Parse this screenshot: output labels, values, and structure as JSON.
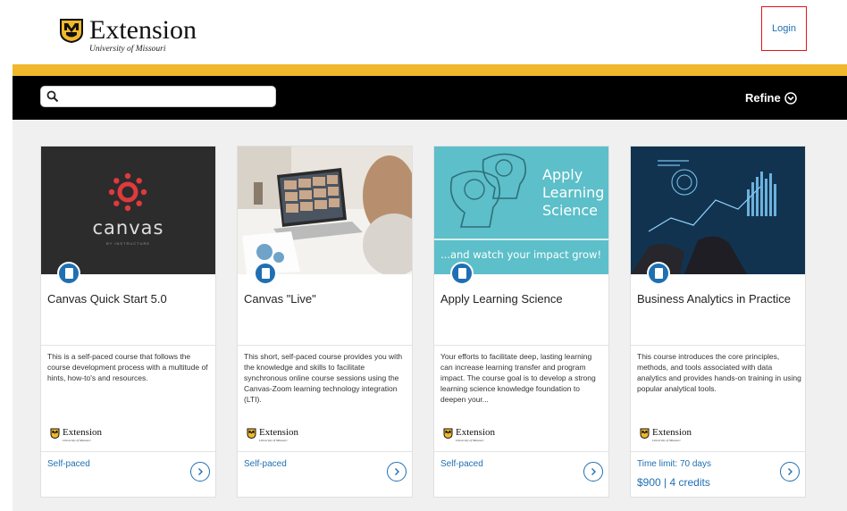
{
  "header": {
    "logo_title": "Extension",
    "logo_subtitle": "University of Missouri",
    "login_label": "Login"
  },
  "toolbar": {
    "search_placeholder": "",
    "refine_label": "Refine"
  },
  "colors": {
    "gold": "#f1b82d",
    "black": "#000000",
    "link_blue": "#1f6fb2",
    "highlight_red": "#e0141c"
  },
  "cards": [
    {
      "title": "Canvas Quick Start 5.0",
      "description": "This is a self-paced course that follows the course development process with a multitude of hints, how-to's and resources.",
      "logo_title": "Extension",
      "logo_subtitle": "University of Missouri",
      "tag": "Self-paced",
      "price": "",
      "image": {
        "brand_name": "canvas",
        "brand_sub": "BY INSTRUCTURE"
      }
    },
    {
      "title": "Canvas \"Live\"",
      "description": "This short, self-paced course provides you with the knowledge and skills to facilitate synchronous online course sessions using the Canvas-Zoom learning technology integration (LTI).",
      "logo_title": "Extension",
      "logo_subtitle": "University of Missouri",
      "tag": "Self-paced",
      "price": "",
      "image": {}
    },
    {
      "title": "Apply Learning Science",
      "description": "Your efforts to facilitate deep, lasting learning can increase learning transfer and program impact. The course goal is to develop a strong learning science knowledge foundation to deepen your...",
      "logo_title": "Extension",
      "logo_subtitle": "University of Missouri",
      "tag": "Self-paced",
      "price": "",
      "image": {
        "line1": "Apply",
        "line2": "Learning",
        "line3": "Science",
        "tagline": "...and watch your impact grow!"
      }
    },
    {
      "title": "Business Analytics in Practice",
      "description": "This course introduces the core principles, methods, and tools associated with data analytics and provides hands-on training in using popular analytical tools.",
      "logo_title": "Extension",
      "logo_subtitle": "University of Missouri",
      "tag": "Time limit: 70 days",
      "price": "$900 | 4 credits",
      "image": {}
    }
  ]
}
